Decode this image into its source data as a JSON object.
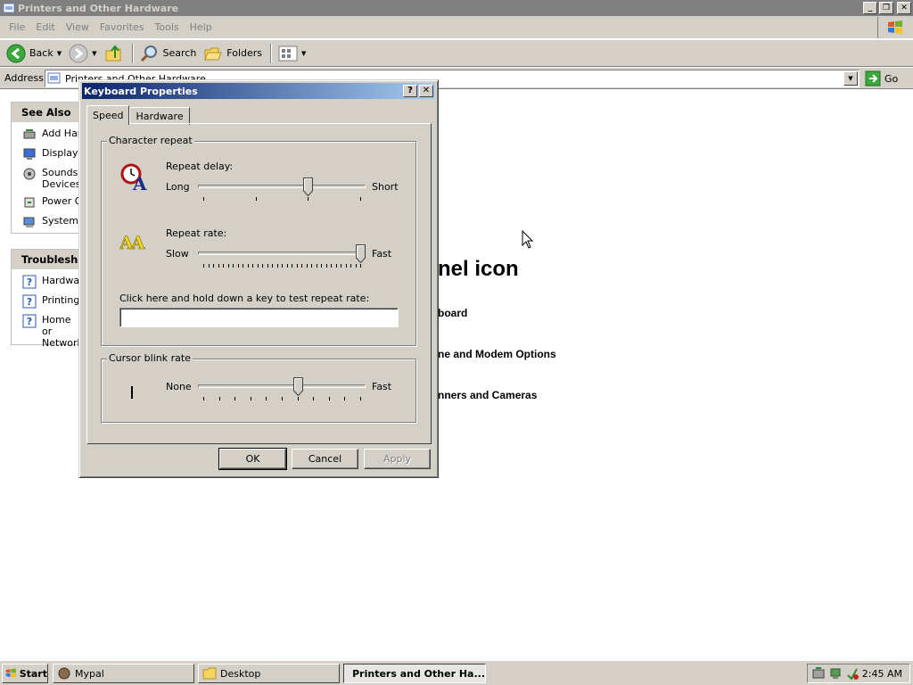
{
  "window": {
    "title": "Printers and Other Hardware",
    "controls": [
      "minimize",
      "restore",
      "close"
    ]
  },
  "menu": {
    "items": [
      "File",
      "Edit",
      "View",
      "Favorites",
      "Tools",
      "Help"
    ]
  },
  "toolbar": {
    "back_label": "Back",
    "search_label": "Search",
    "folders_label": "Folders"
  },
  "address": {
    "label": "Address",
    "value": "Printers and Other Hardware",
    "go_label": "Go"
  },
  "see_also": {
    "title": "See Also",
    "items": [
      {
        "label": "Add Hard",
        "icon": "add-hardware-icon"
      },
      {
        "label": "Display",
        "icon": "display-icon"
      },
      {
        "label": "Sounds, Devices",
        "icon": "sounds-icon"
      },
      {
        "label": "Power O",
        "icon": "power-icon"
      },
      {
        "label": "System",
        "icon": "system-icon"
      }
    ]
  },
  "troubleshooters": {
    "title": "Troubleshoo",
    "items": [
      {
        "label": "Hardwar",
        "icon": "help-icon"
      },
      {
        "label": "Printing",
        "icon": "help-icon"
      },
      {
        "label": "Home or Network",
        "icon": "help-icon"
      }
    ]
  },
  "content": {
    "heading": "nel icon",
    "links": [
      "board",
      "ne and Modem Options",
      "nners and Cameras"
    ]
  },
  "dialog": {
    "title": "Keyboard Properties",
    "tabs": [
      "Speed",
      "Hardware"
    ],
    "char_repeat": {
      "group_label": "Character repeat",
      "delay_label": "Repeat delay:",
      "delay_min": "Long",
      "delay_max": "Short",
      "delay_value": 0.667,
      "rate_label": "Repeat rate:",
      "rate_min": "Slow",
      "rate_max": "Fast",
      "rate_value": 1.0,
      "test_label": "Click here and hold down a key to test repeat rate:",
      "test_value": ""
    },
    "cursor_blink": {
      "group_label": "Cursor blink rate",
      "min": "None",
      "max": "Fast",
      "value": 0.6
    },
    "buttons": {
      "ok": "OK",
      "cancel": "Cancel",
      "apply": "Apply"
    }
  },
  "taskbar": {
    "start_label": "Start",
    "tasks": [
      "Mypal",
      "Desktop",
      "Printers and Other Ha..."
    ],
    "clock": "2:45 AM"
  },
  "colors": {
    "title_active_start": "#0a246a",
    "title_active_end": "#a6caf0",
    "title_inactive": "#808080",
    "face": "#d4d0c8"
  }
}
